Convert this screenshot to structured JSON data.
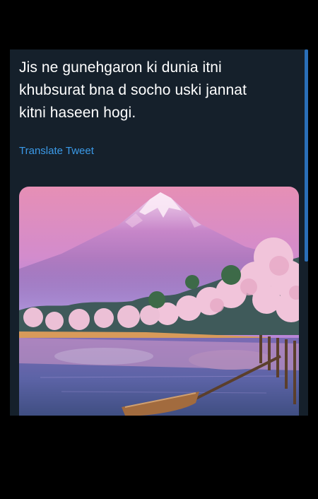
{
  "tweet": {
    "text_lines": [
      "Jis ne gunehgaron ki dunia itni",
      "khubsurat bna d socho uski jannat",
      "kitni haseen hogi."
    ],
    "translate_label": "Translate Tweet"
  },
  "media": {
    "subject": "mount-fuji-cherry-blossom-lake-photo"
  },
  "colors": {
    "background": "#000000",
    "panel": "#15202b",
    "text": "#ffffff",
    "link": "#3b9ae8",
    "scrollbar": "#2a6fb8"
  }
}
